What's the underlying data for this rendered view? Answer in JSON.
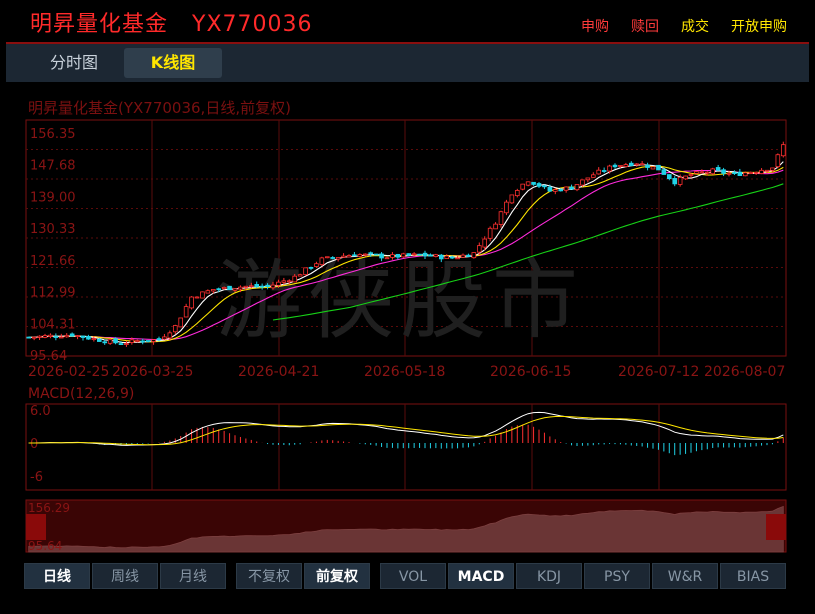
{
  "header": {
    "fund_name": "明昇量化基金",
    "fund_code": "YX770036",
    "actions": [
      {
        "label": "申购",
        "color": "#ff3b3b"
      },
      {
        "label": "赎回",
        "color": "#ff3b3b"
      },
      {
        "label": "成交",
        "color": "#ffe600"
      },
      {
        "label": "开放申购",
        "color": "#ffe600"
      }
    ]
  },
  "tabs": [
    "分时图",
    "K线图"
  ],
  "active_tab": "K线图",
  "watermark": "游侠股市",
  "chart_data": [
    {
      "type": "candlestick",
      "title": "明昇量化基金(YX770036,日线,前复权)",
      "y_ticks": [
        "156.35",
        "147.68",
        "139.00",
        "130.33",
        "121.66",
        "112.99",
        "104.31",
        "95.64"
      ],
      "ylim": [
        95.64,
        156.35
      ],
      "x_ticks": [
        "2026-02-25",
        "2026-03-25",
        "2026-04-21",
        "2026-05-18",
        "2026-06-15",
        "2026-07-12",
        "2026-08-07"
      ],
      "segments": [
        {
          "from": 0,
          "to": 8,
          "start": 100.5,
          "end": 101.2
        },
        {
          "from": 8,
          "to": 12,
          "start": 101.2,
          "end": 100.0
        },
        {
          "from": 12,
          "to": 17,
          "start": 100.0,
          "end": 98.8
        },
        {
          "from": 17,
          "to": 20,
          "start": 98.8,
          "end": 99.5
        },
        {
          "from": 20,
          "to": 24,
          "start": 99.5,
          "end": 99.8
        },
        {
          "from": 24,
          "to": 27,
          "start": 99.8,
          "end": 103.5
        },
        {
          "from": 27,
          "to": 30,
          "start": 103.5,
          "end": 111.5
        },
        {
          "from": 30,
          "to": 34,
          "start": 111.5,
          "end": 113.6
        },
        {
          "from": 34,
          "to": 40,
          "start": 113.6,
          "end": 114.4
        },
        {
          "from": 40,
          "to": 44,
          "start": 114.4,
          "end": 114.3
        },
        {
          "from": 44,
          "to": 49,
          "start": 114.3,
          "end": 117.0
        },
        {
          "from": 49,
          "to": 54,
          "start": 117.0,
          "end": 121.8
        },
        {
          "from": 54,
          "to": 60,
          "start": 121.8,
          "end": 123.2
        },
        {
          "from": 60,
          "to": 66,
          "start": 123.2,
          "end": 122.5
        },
        {
          "from": 66,
          "to": 72,
          "start": 122.5,
          "end": 123.0
        },
        {
          "from": 72,
          "to": 78,
          "start": 123.0,
          "end": 122.2
        },
        {
          "from": 78,
          "to": 82,
          "start": 122.2,
          "end": 123.5
        },
        {
          "from": 82,
          "to": 86,
          "start": 123.5,
          "end": 132.0
        },
        {
          "from": 86,
          "to": 89,
          "start": 132.0,
          "end": 140.0
        },
        {
          "from": 89,
          "to": 92,
          "start": 140.0,
          "end": 143.5
        },
        {
          "from": 92,
          "to": 96,
          "start": 143.5,
          "end": 140.5
        },
        {
          "from": 96,
          "to": 100,
          "start": 140.5,
          "end": 141.5
        },
        {
          "from": 100,
          "to": 104,
          "start": 141.5,
          "end": 145.0
        },
        {
          "from": 104,
          "to": 108,
          "start": 145.0,
          "end": 147.5
        },
        {
          "from": 108,
          "to": 112,
          "start": 147.5,
          "end": 148.2
        },
        {
          "from": 112,
          "to": 116,
          "start": 148.2,
          "end": 146.5
        },
        {
          "from": 116,
          "to": 119,
          "start": 146.5,
          "end": 143.0
        },
        {
          "from": 119,
          "to": 122,
          "start": 143.0,
          "end": 145.0
        },
        {
          "from": 122,
          "to": 126,
          "start": 145.0,
          "end": 146.0
        },
        {
          "from": 126,
          "to": 130,
          "start": 146.0,
          "end": 145.0
        },
        {
          "from": 130,
          "to": 134,
          "start": 145.0,
          "end": 146.0
        },
        {
          "from": 134,
          "to": 137,
          "start": 146.0,
          "end": 147.0
        },
        {
          "from": 137,
          "to": 139,
          "start": 147.0,
          "end": 153.0
        }
      ],
      "n_bars": 140,
      "ma_colors": {
        "ma5": "#ffffff",
        "ma10": "#ffe600",
        "ma20": "#ff2bdc",
        "ma60": "#17d117"
      },
      "up_color": "#ff3030",
      "down_color": "#20d2e6"
    },
    {
      "type": "line",
      "title": "MACD(12,26,9)",
      "y_ticks": [
        "6.0",
        "0",
        "-6"
      ],
      "ylim": [
        -6,
        6
      ],
      "series": [
        {
          "values": "derived from close prices (DIF, DEA, MACD bars)"
        }
      ]
    },
    {
      "type": "area",
      "title": "",
      "y_ticks": [
        "156.29",
        "95.64"
      ],
      "ylim": [
        95.64,
        156.29
      ]
    }
  ],
  "buttons": {
    "period": [
      {
        "label": "日线",
        "active": true
      },
      {
        "label": "周线",
        "active": false
      },
      {
        "label": "月线",
        "active": false
      }
    ],
    "adjust": [
      {
        "label": "不复权",
        "active": false
      },
      {
        "label": "前复权",
        "active": true
      }
    ],
    "indicators": [
      {
        "label": "VOL",
        "active": false
      },
      {
        "label": "MACD",
        "active": true
      },
      {
        "label": "KDJ",
        "active": false
      },
      {
        "label": "PSY",
        "active": false
      },
      {
        "label": "W&R",
        "active": false
      },
      {
        "label": "BIAS",
        "active": false
      }
    ]
  }
}
